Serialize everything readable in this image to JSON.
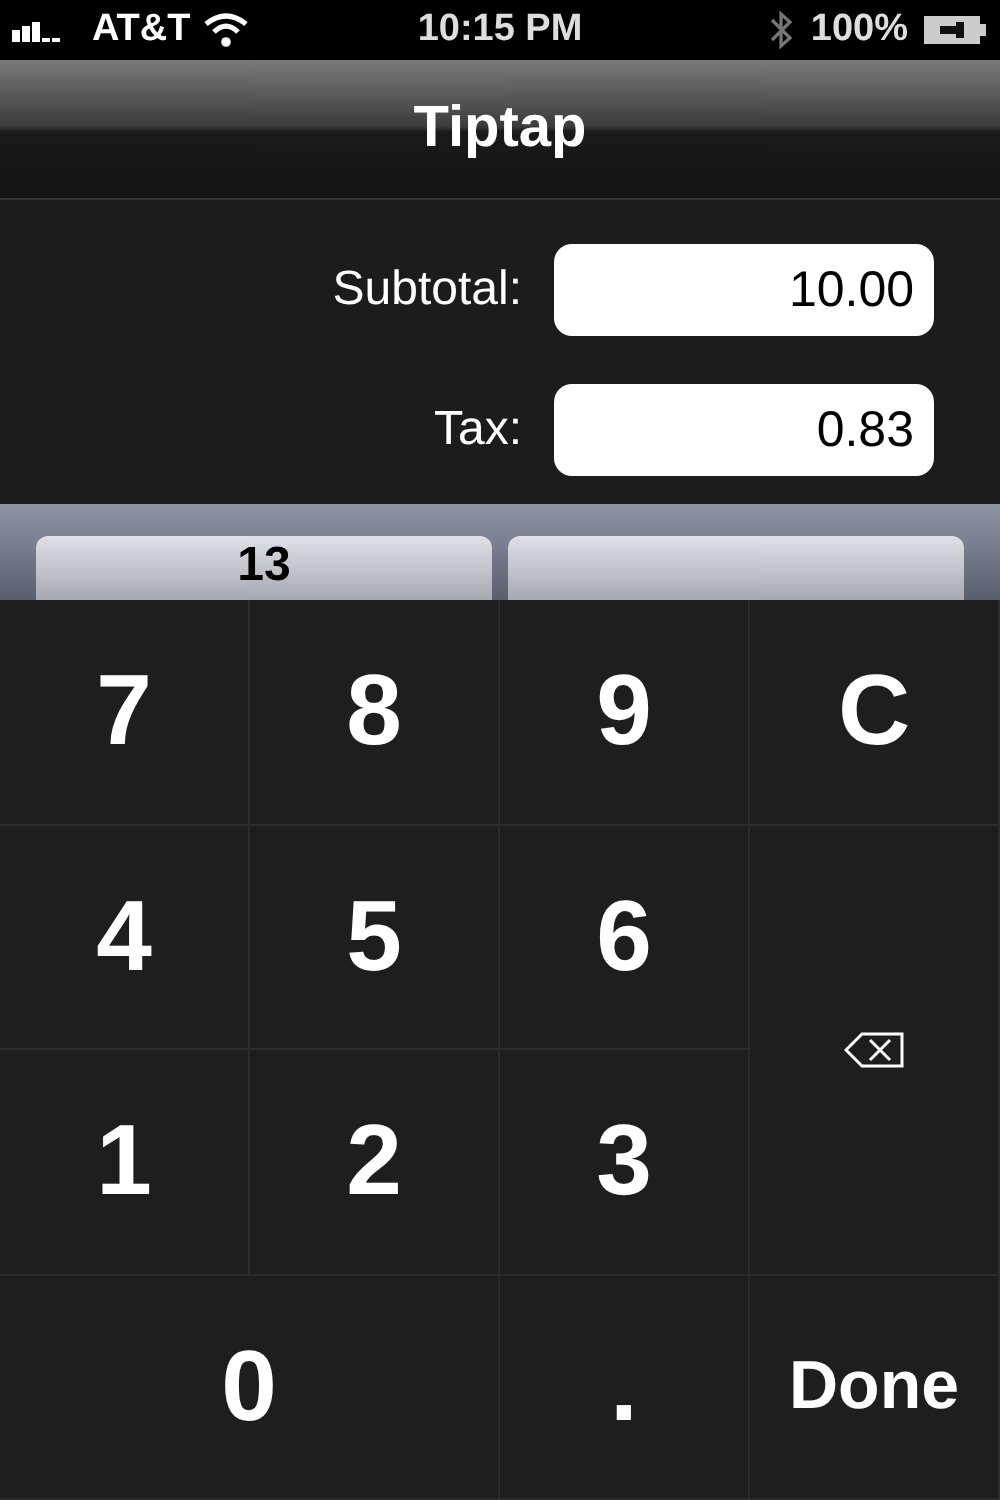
{
  "status_bar": {
    "carrier": "AT&T",
    "time": "10:15 PM",
    "battery": "100%"
  },
  "nav_bar": {
    "title": "Tiptap"
  },
  "fields": [
    {
      "label": "Subtotal:",
      "value": "10.00"
    },
    {
      "label": "Tax:",
      "value": "0.83"
    }
  ],
  "picker": {
    "selected_value": "13"
  },
  "keypad": [
    {
      "kind": "key",
      "label": "7"
    },
    {
      "kind": "key",
      "label": "8"
    },
    {
      "kind": "key",
      "label": "9"
    },
    {
      "kind": "key",
      "label": "C"
    },
    {
      "kind": "key",
      "label": "4"
    },
    {
      "kind": "key",
      "label": "5"
    },
    {
      "kind": "key",
      "label": "6"
    },
    {
      "kind": "backspace"
    },
    {
      "kind": "key",
      "label": "1"
    },
    {
      "kind": "key",
      "label": "2"
    },
    {
      "kind": "key",
      "label": "3"
    },
    {
      "kind": "wide",
      "label": "0"
    },
    {
      "kind": "key",
      "label": "."
    },
    {
      "kind": "key",
      "label": "Done"
    }
  ]
}
